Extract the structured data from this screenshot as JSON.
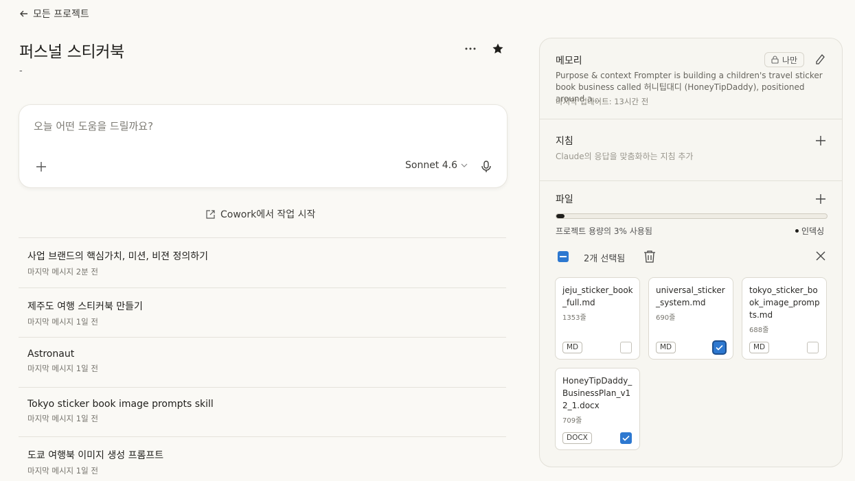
{
  "nav": {
    "back_label": "모든 프로젝트"
  },
  "project": {
    "title": "퍼스널 스티커북",
    "description": "-"
  },
  "composer": {
    "placeholder": "오늘 어떤 도움을 드릴까요?",
    "model": "Sonnet 4.6"
  },
  "cowork": {
    "label": "Cowork에서 작업 시작"
  },
  "conversations": [
    {
      "title": "사업 브랜드의 핵심가치, 미션, 비젼 정의하기",
      "meta": "마지막 메시지 2분 전"
    },
    {
      "title": "제주도 여행 스티커북 만들기",
      "meta": "마지막 메시지 1일 전"
    },
    {
      "title": "Astronaut",
      "meta": "마지막 메시지 1일 전"
    },
    {
      "title": "Tokyo sticker book image prompts skill",
      "meta": "마지막 메시지 1일 전"
    },
    {
      "title": "도쿄 여행북 이미지 생성 프롬프트",
      "meta": "마지막 메시지 1일 전"
    }
  ],
  "memory": {
    "title": "메모리",
    "visibility": "나만",
    "text": "Purpose & context Frompter is building a children's travel sticker book business called 허니팁대디 (HoneyTipDaddy), positioned around a…",
    "updated": "마지막 업데이트: 13시간 전"
  },
  "instructions": {
    "title": "지침",
    "subtitle": "Claude의 응답을 맞춤화하는 지침 추가"
  },
  "files": {
    "title": "파일",
    "usage_percent": 3,
    "usage_text": "프로젝트 용량의 3% 사용됨",
    "index_status": "인덱싱",
    "selection_text": "2개 선택됨",
    "items": [
      {
        "name": "jeju_sticker_book_full.md",
        "lines": "1353줄",
        "type": "MD",
        "checked": false
      },
      {
        "name": "universal_sticker_system.md",
        "lines": "690줄",
        "type": "MD",
        "checked": true
      },
      {
        "name": "tokyo_sticker_book_image_prompts.md",
        "lines": "688줄",
        "type": "MD",
        "checked": false
      },
      {
        "name": "HoneyTipDaddy_BusinessPlan_v12_1.docx",
        "lines": "709줄",
        "type": "DOCX",
        "checked": true
      }
    ]
  },
  "colors": {
    "accent": "#2d78d0",
    "background": "#faf9f5",
    "panel": "#f7f6f1"
  }
}
